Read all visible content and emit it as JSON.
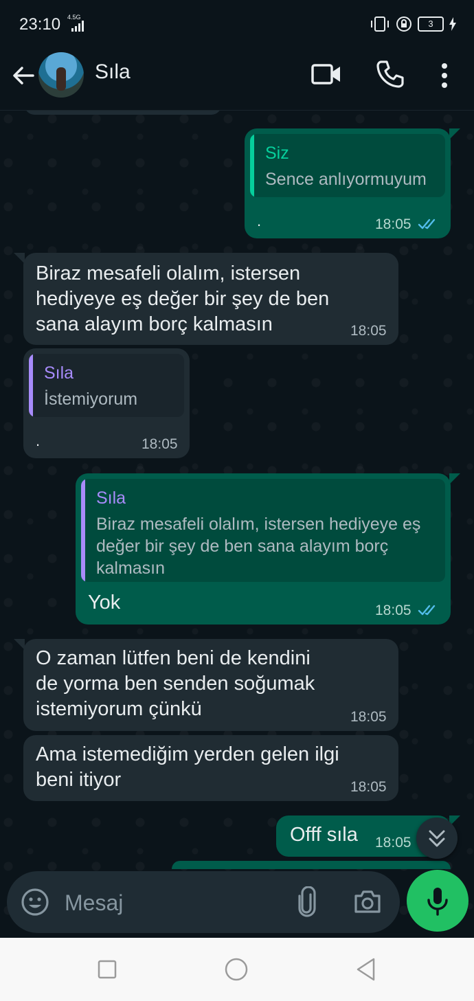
{
  "status_bar": {
    "time": "23:10",
    "network": "4.5G",
    "battery": "3"
  },
  "header": {
    "contact_name": "Sıla"
  },
  "messages": [
    {
      "direction": "outgoing",
      "quote_author": "Siz",
      "quote_text": "Sence anlıyormuyum",
      "text": ".",
      "time": "18:05",
      "status": "read"
    },
    {
      "direction": "incoming",
      "text": "Biraz mesafeli olalım, istersen hediyeye eş değer bir şey de ben sana alayım borç kalmasın",
      "time": "18:05"
    },
    {
      "direction": "incoming",
      "quote_author": "Sıla",
      "quote_text": "İstemiyorum",
      "text": ".",
      "time": "18:05"
    },
    {
      "direction": "outgoing",
      "quote_author": "Sıla",
      "quote_text": "Biraz mesafeli olalım, istersen hediyeye eş değer bir şey de ben sana alayım borç kalmasın",
      "text": "Yok",
      "time": "18:05",
      "status": "read"
    },
    {
      "direction": "incoming",
      "text": "O zaman lütfen beni de kendini de yorma ben senden soğumak istemiyorum çünkü",
      "time": "18:05"
    },
    {
      "direction": "incoming",
      "text": "Ama istemediğim yerden gelen ilgi beni itiyor",
      "time": "18:05"
    },
    {
      "direction": "outgoing",
      "text": "Offf sıla",
      "time": "18:05"
    }
  ],
  "composer": {
    "placeholder": "Mesaj"
  },
  "colors": {
    "outgoing_bubble": "#005c4b",
    "incoming_bubble": "#202c33",
    "background": "#0b141a",
    "accent_green": "#21c063",
    "read_ticks": "#53bdeb",
    "quote_self": "#06cf9c",
    "quote_contact": "#a78bfa"
  },
  "icons": [
    "back-arrow-icon",
    "video-call-icon",
    "phone-icon",
    "more-vert-icon",
    "emoji-icon",
    "attach-icon",
    "camera-icon",
    "mic-icon",
    "chevron-down-icon",
    "double-check-icon",
    "nav-recent-icon",
    "nav-home-icon",
    "nav-back-icon"
  ]
}
